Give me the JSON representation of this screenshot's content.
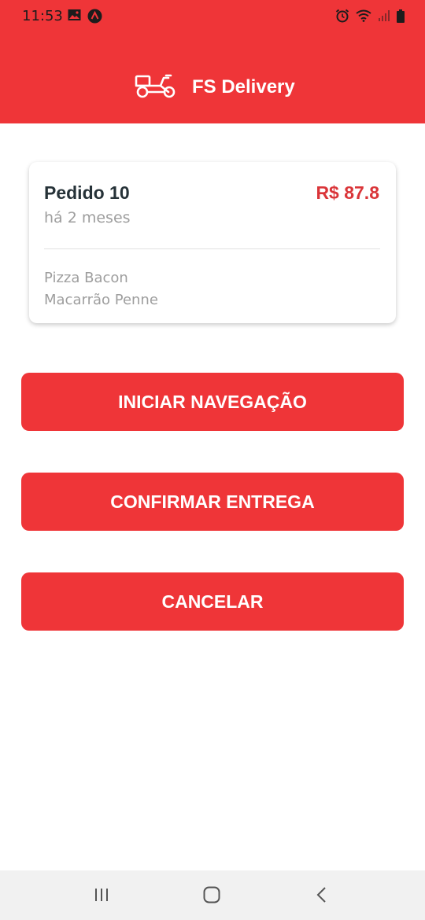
{
  "status_bar": {
    "time": "11:53"
  },
  "header": {
    "title": "FS Delivery",
    "logo_icon": "delivery-scooter-icon"
  },
  "order": {
    "title": "Pedido 10",
    "price": "R$ 87.8",
    "time_ago": "há 2 meses",
    "items": [
      "Pizza Bacon",
      "Macarrão Penne"
    ]
  },
  "actions": {
    "start_navigation": "INICIAR NAVEGAÇÃO",
    "confirm_delivery": "CONFIRMAR ENTREGA",
    "cancel": "CANCELAR"
  },
  "colors": {
    "primary": "#ef3538",
    "price": "#da3539",
    "title_text": "#263238",
    "muted_text": "#9e9e9e"
  }
}
